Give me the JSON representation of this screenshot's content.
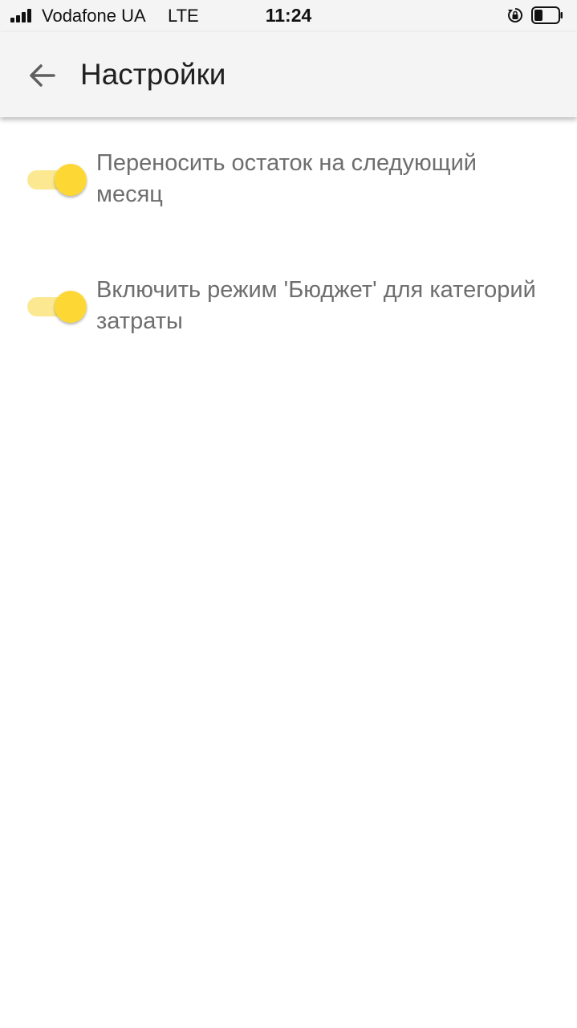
{
  "status_bar": {
    "carrier": "Vodafone UA",
    "network": "LTE",
    "time": "11:24",
    "icons": [
      "signal-icon",
      "rotation-lock-icon",
      "battery-icon"
    ]
  },
  "app_bar": {
    "back_icon": "arrow-left-icon",
    "title": "Настройки"
  },
  "settings": [
    {
      "label": "Переносить остаток на следующий месяц",
      "enabled": true
    },
    {
      "label": "Включить режим 'Бюджет' для категорий затраты",
      "enabled": true
    }
  ],
  "colors": {
    "accent": "#fdd835",
    "accent_track": "#fbe891",
    "app_bar_bg": "#f4f4f4",
    "label_text": "#6e6e6e"
  }
}
